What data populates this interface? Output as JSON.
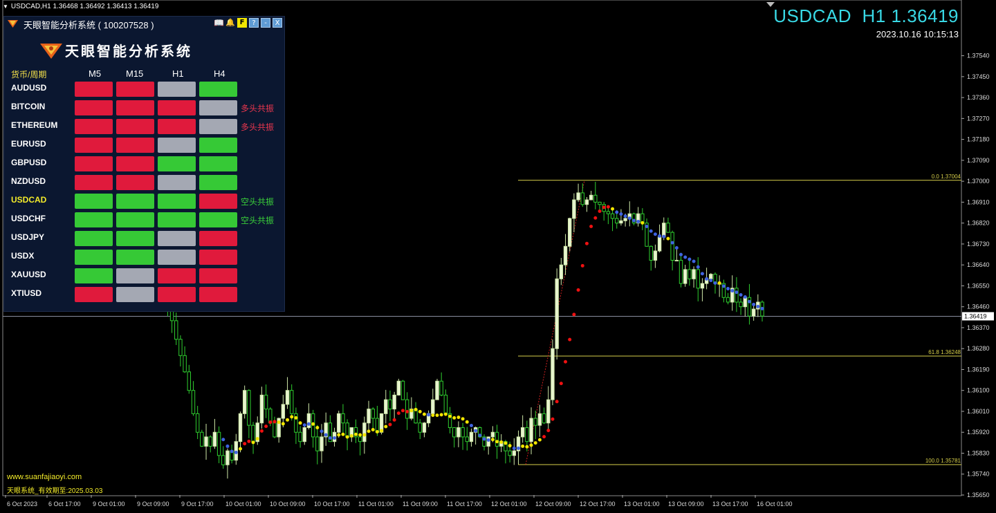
{
  "top_bar": {
    "symbol_info": "USDCAD,H1  1.36468 1.36492 1.36413 1.36419"
  },
  "header_display": {
    "symbol": "USDCAD",
    "timeframe": "H1",
    "price": "1.36419",
    "datetime": "2023.10.16 10:15:13"
  },
  "colors": {
    "up": "#cfe8a8",
    "down": "#2fd02f",
    "red": "#e01a3c",
    "green": "#36c936",
    "gray": "#a4a8b3",
    "fibo": "#d8d04a",
    "accent": "#39d9e6"
  },
  "panel": {
    "title": "天眼智能分析系统 ( 100207528 )",
    "brand": "天眼智能分析系统",
    "buttons": [
      {
        "icon": "book-icon",
        "label": "📖"
      },
      {
        "icon": "bell-icon",
        "label": "🔔"
      },
      {
        "icon": "f-button",
        "label": "F"
      },
      {
        "icon": "help-icon",
        "label": "?"
      },
      {
        "icon": "minimize-icon",
        "label": "-"
      },
      {
        "icon": "close-icon",
        "label": "X"
      }
    ],
    "header_label": "货币/周期",
    "periods": [
      "M5",
      "M15",
      "H1",
      "H4"
    ],
    "rows": [
      {
        "symbol": "AUDUSD",
        "cells": [
          "red",
          "red",
          "gray",
          "green"
        ],
        "tag": "",
        "highlight": false
      },
      {
        "symbol": "BITCOIN",
        "cells": [
          "red",
          "red",
          "red",
          "gray"
        ],
        "tag": "多头共振",
        "tag_color": "red",
        "highlight": false
      },
      {
        "symbol": "ETHEREUM",
        "cells": [
          "red",
          "red",
          "red",
          "gray"
        ],
        "tag": "多头共振",
        "tag_color": "red",
        "highlight": false
      },
      {
        "symbol": "EURUSD",
        "cells": [
          "red",
          "red",
          "gray",
          "green"
        ],
        "tag": "",
        "highlight": false
      },
      {
        "symbol": "GBPUSD",
        "cells": [
          "red",
          "red",
          "green",
          "green"
        ],
        "tag": "",
        "highlight": false
      },
      {
        "symbol": "NZDUSD",
        "cells": [
          "red",
          "red",
          "gray",
          "green"
        ],
        "tag": "",
        "highlight": false
      },
      {
        "symbol": "USDCAD",
        "cells": [
          "green",
          "green",
          "green",
          "red"
        ],
        "tag": "空头共振",
        "tag_color": "green",
        "highlight": true
      },
      {
        "symbol": "USDCHF",
        "cells": [
          "green",
          "green",
          "green",
          "green"
        ],
        "tag": "空头共振",
        "tag_color": "green",
        "highlight": false
      },
      {
        "symbol": "USDJPY",
        "cells": [
          "green",
          "green",
          "gray",
          "red"
        ],
        "tag": "",
        "highlight": false
      },
      {
        "symbol": "USDX",
        "cells": [
          "green",
          "green",
          "gray",
          "red"
        ],
        "tag": "",
        "highlight": false
      },
      {
        "symbol": "XAUUSD",
        "cells": [
          "green",
          "gray",
          "red",
          "red"
        ],
        "tag": "",
        "highlight": false
      },
      {
        "symbol": "XTIUSD",
        "cells": [
          "red",
          "gray",
          "red",
          "red"
        ],
        "tag": "",
        "highlight": false
      }
    ]
  },
  "footer": {
    "url": "www.suanfajiaoyi.com",
    "expiry": "天眼系统_有效期至:2025.03.03"
  },
  "chart_data": {
    "type": "candlestick",
    "y_range": [
      1.3565,
      1.3775
    ],
    "y_ticks": [
      "1.37540",
      "1.37450",
      "1.37360",
      "1.37270",
      "1.37180",
      "1.37090",
      "1.37000",
      "1.36910",
      "1.36820",
      "1.36730",
      "1.36640",
      "1.36550",
      "1.36460",
      "1.36370",
      "1.36280",
      "1.36190",
      "1.36100",
      "1.36010",
      "1.35920",
      "1.35830",
      "1.35740",
      "1.35650"
    ],
    "current_price": "1.36419",
    "x_ticks": [
      "6 Oct 2023",
      "6 Oct 17:00",
      "9 Oct 01:00",
      "9 Oct 09:00",
      "9 Oct 17:00",
      "10 Oct 01:00",
      "10 Oct 09:00",
      "10 Oct 17:00",
      "11 Oct 01:00",
      "11 Oct 09:00",
      "11 Oct 17:00",
      "12 Oct 01:00",
      "12 Oct 09:00",
      "12 Oct 17:00",
      "13 Oct 01:00",
      "13 Oct 09:00",
      "13 Oct 17:00",
      "16 Oct 01:00"
    ],
    "fibo_levels": [
      {
        "label": "0.0",
        "price": "1.37004",
        "value": 1.37004
      },
      {
        "label": "61.8",
        "price": "1.36248",
        "value": 1.36248
      },
      {
        "label": "100.0",
        "price": "1.35781",
        "value": 1.35781
      }
    ],
    "close_series": [
      1.365,
      1.3649,
      1.3645,
      1.364,
      1.3632,
      1.3625,
      1.3618,
      1.361,
      1.36,
      1.3592,
      1.3586,
      1.359,
      1.3586,
      1.3592,
      1.3582,
      1.3578,
      1.3584,
      1.358,
      1.3588,
      1.36,
      1.361,
      1.3595,
      1.3588,
      1.3596,
      1.3608,
      1.3602,
      1.3596,
      1.359,
      1.3598,
      1.3604,
      1.361,
      1.36,
      1.3592,
      1.3588,
      1.3594,
      1.36,
      1.359,
      1.3584,
      1.359,
      1.3596,
      1.3588,
      1.3592,
      1.36,
      1.3596,
      1.359,
      1.3594,
      1.359,
      1.3588,
      1.3596,
      1.3602,
      1.3598,
      1.3592,
      1.36,
      1.3606,
      1.3602,
      1.3608,
      1.3614,
      1.3606,
      1.3598,
      1.3602,
      1.3596,
      1.3592,
      1.3596,
      1.36,
      1.3606,
      1.3614,
      1.3608,
      1.36,
      1.3594,
      1.359,
      1.3594,
      1.359,
      1.3588,
      1.3592,
      1.3594,
      1.359,
      1.3586,
      1.359,
      1.3592,
      1.3586,
      1.3588,
      1.3584,
      1.3582,
      1.3584,
      1.359,
      1.3594,
      1.3588,
      1.3598,
      1.3595,
      1.36,
      1.3596,
      1.3606,
      1.3628,
      1.3658,
      1.3664,
      1.3672,
      1.3684,
      1.3692,
      1.3695,
      1.369,
      1.3692,
      1.3694,
      1.3691,
      1.369,
      1.3687,
      1.3686,
      1.3684,
      1.3682,
      1.3683,
      1.3684,
      1.3686,
      1.3682,
      1.3686,
      1.3682,
      1.3672,
      1.3666,
      1.367,
      1.3676,
      1.3682,
      1.3678,
      1.3666,
      1.3666,
      1.3656,
      1.3662,
      1.3658,
      1.3662,
      1.3654,
      1.3656,
      1.3658,
      1.366,
      1.3656,
      1.3656,
      1.365,
      1.3648,
      1.3654,
      1.3648,
      1.3646,
      1.365,
      1.3642,
      1.3645,
      1.3648,
      1.3642
    ]
  }
}
